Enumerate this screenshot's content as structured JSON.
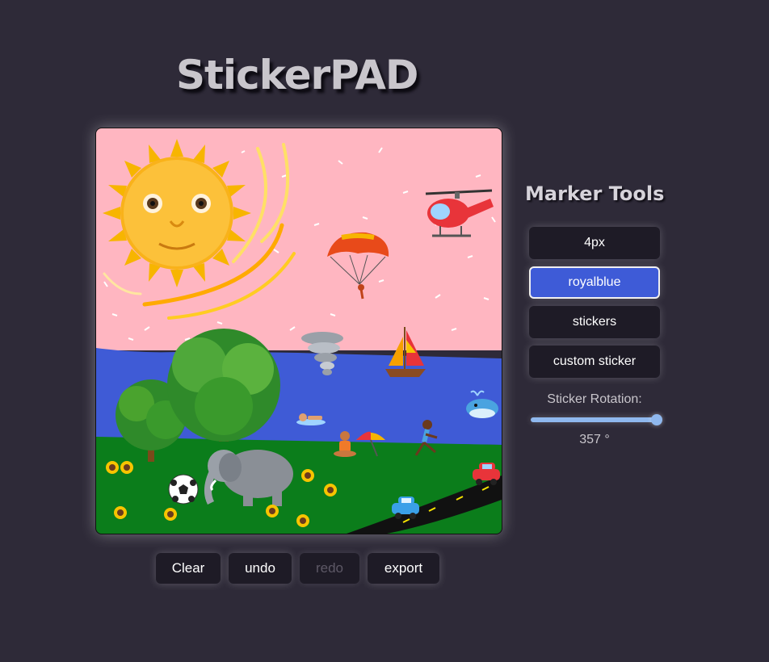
{
  "app": {
    "title": "StickerPAD"
  },
  "marker_tools": {
    "heading": "Marker Tools",
    "buttons": [
      {
        "label": "4px",
        "active": false
      },
      {
        "label": "royalblue",
        "active": true
      },
      {
        "label": "stickers",
        "active": false
      },
      {
        "label": "custom sticker",
        "active": false
      }
    ],
    "rotation_label": "Sticker Rotation:",
    "rotation_value": "357 °",
    "rotation_fraction": 0.99
  },
  "actions": {
    "clear": "Clear",
    "undo": "undo",
    "redo": "redo",
    "export": "export"
  },
  "colors": {
    "background": "#2e2a38",
    "sky": "#ffb6c1",
    "water": "royalblue",
    "grass": "#0a7d1a",
    "active_button": "#3e5bd7"
  },
  "canvas": {
    "stickers": [
      "sun-with-face",
      "helicopter",
      "parachute",
      "tornado",
      "sailboat",
      "whale",
      "swimmer",
      "beach-umbrella",
      "person-meditating",
      "runner",
      "tree",
      "elephant",
      "soccer-ball",
      "sunflower",
      "car-red",
      "car-blue",
      "road"
    ]
  }
}
